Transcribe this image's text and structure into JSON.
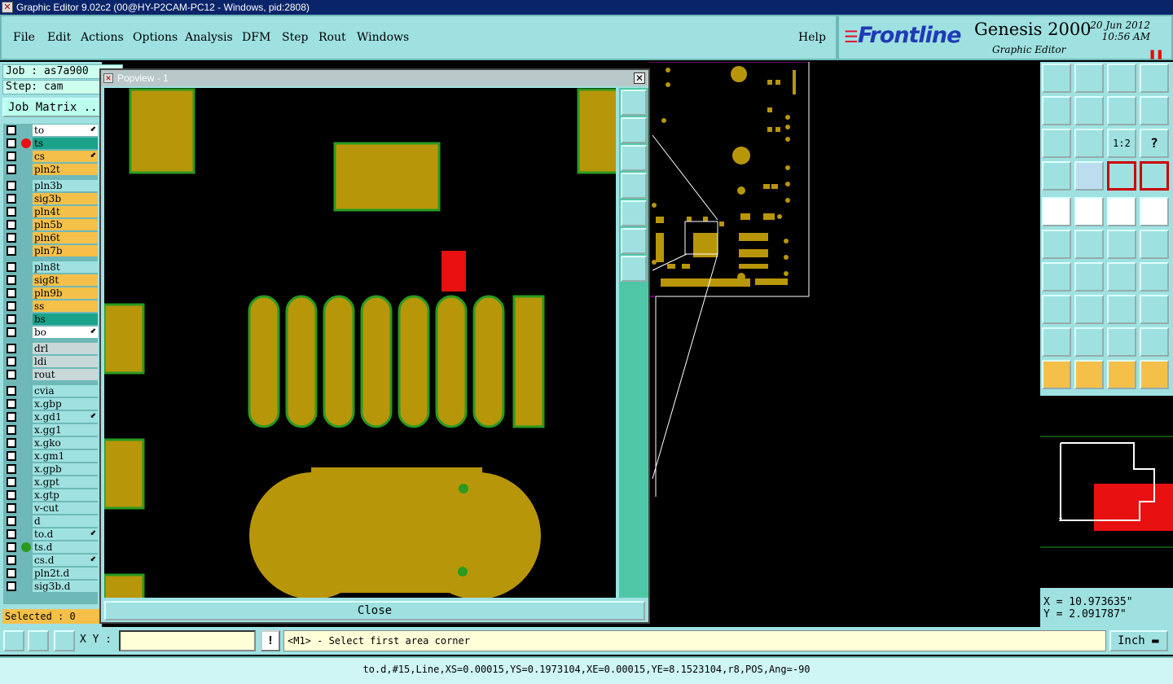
{
  "window": {
    "title": "Graphic Editor 9.02c2 (00@HY-P2CAM-PC12 - Windows, pid:2808)"
  },
  "menu": [
    {
      "label": "File"
    },
    {
      "label": "Edit"
    },
    {
      "label": "Actions"
    },
    {
      "label": "Options"
    },
    {
      "label": "Analysis"
    },
    {
      "label": "DFM"
    },
    {
      "label": "Step"
    },
    {
      "label": "Rout"
    },
    {
      "label": "Windows"
    }
  ],
  "help_label": "Help",
  "brand": {
    "logo": "Frontline",
    "product": "Genesis 2000",
    "subtitle": "Graphic Editor",
    "date": "20 Jun 2012",
    "time": "10:56 AM"
  },
  "job": {
    "job_label": "Job : as7a900",
    "step_label": "Step: cam",
    "matrix_label": "Job Matrix ..."
  },
  "layers": [
    {
      "name": "to",
      "color": "#ffffff",
      "arrow": true
    },
    {
      "name": "ts",
      "color": "#1aa28a",
      "dot": "#e81010"
    },
    {
      "name": "cs",
      "color": "#f5c04a",
      "arrow": true
    },
    {
      "name": "pln2t",
      "color": "#f5c04a"
    },
    {
      "name": "pln3b",
      "color": "#9fe1e1",
      "nochk": true
    },
    {
      "name": "sig3b",
      "color": "#f5c04a"
    },
    {
      "name": "pln4t",
      "color": "#f5c04a"
    },
    {
      "name": "pln5b",
      "color": "#f5c04a"
    },
    {
      "name": "pln6t",
      "color": "#f5c04a"
    },
    {
      "name": "pln7b",
      "color": "#f5c04a"
    },
    {
      "name": "pln8t",
      "color": "#9fe1e1",
      "nochk": true
    },
    {
      "name": "sig8t",
      "color": "#f5c04a"
    },
    {
      "name": "pln9b",
      "color": "#f5c04a"
    },
    {
      "name": "ss",
      "color": "#f5c04a"
    },
    {
      "name": "bs",
      "color": "#1aa28a"
    },
    {
      "name": "bo",
      "color": "#ffffff",
      "arrow": true
    },
    {
      "name": "drl",
      "color": "#c8d8d8"
    },
    {
      "name": "ldi",
      "color": "#c8d8d8"
    },
    {
      "name": "rout",
      "color": "#c8d8d8"
    },
    {
      "name": "cvia",
      "color": "#9fe1e1"
    },
    {
      "name": "x.gbp",
      "color": "#9fe1e1"
    },
    {
      "name": "x.gd1",
      "color": "#9fe1e1",
      "arrow": true
    },
    {
      "name": "x.gg1",
      "color": "#9fe1e1"
    },
    {
      "name": "x.gko",
      "color": "#9fe1e1"
    },
    {
      "name": "x.gm1",
      "color": "#9fe1e1"
    },
    {
      "name": "x.gpb",
      "color": "#9fe1e1"
    },
    {
      "name": "x.gpt",
      "color": "#9fe1e1"
    },
    {
      "name": "x.gtp",
      "color": "#9fe1e1"
    },
    {
      "name": "v-cut",
      "color": "#9fe1e1"
    },
    {
      "name": "d",
      "color": "#9fe1e1"
    },
    {
      "name": "to.d",
      "color": "#9fe1e1",
      "arrow": true
    },
    {
      "name": "ts.d",
      "color": "#9fe1e1",
      "dot": "#2a9a20"
    },
    {
      "name": "cs.d",
      "color": "#9fe1e1",
      "arrow": true
    },
    {
      "name": "pln2t.d",
      "color": "#9fe1e1"
    },
    {
      "name": "sig3b.d",
      "color": "#9fe1e1"
    }
  ],
  "selected_label": "Selected : 0",
  "popview": {
    "title": "Popview - 1",
    "close_label": "Close"
  },
  "coords": {
    "x": "X = 10.973635\"",
    "y": "Y = 2.091787\""
  },
  "cmd": {
    "xy_label": "X Y :",
    "xy_value": "",
    "prompt": "<M1> - Select first area corner",
    "units": "Inch"
  },
  "status": "to.d,#15,Line,XS=0.00015,YS=0.1973104,XE=0.00015,YE=8.1523104,r8,POS,Ang=-90",
  "colors": {
    "panel": "#9fe1e1",
    "copper": "#b8960a",
    "highlight": "#e81010",
    "outline": "#2a9a20"
  }
}
